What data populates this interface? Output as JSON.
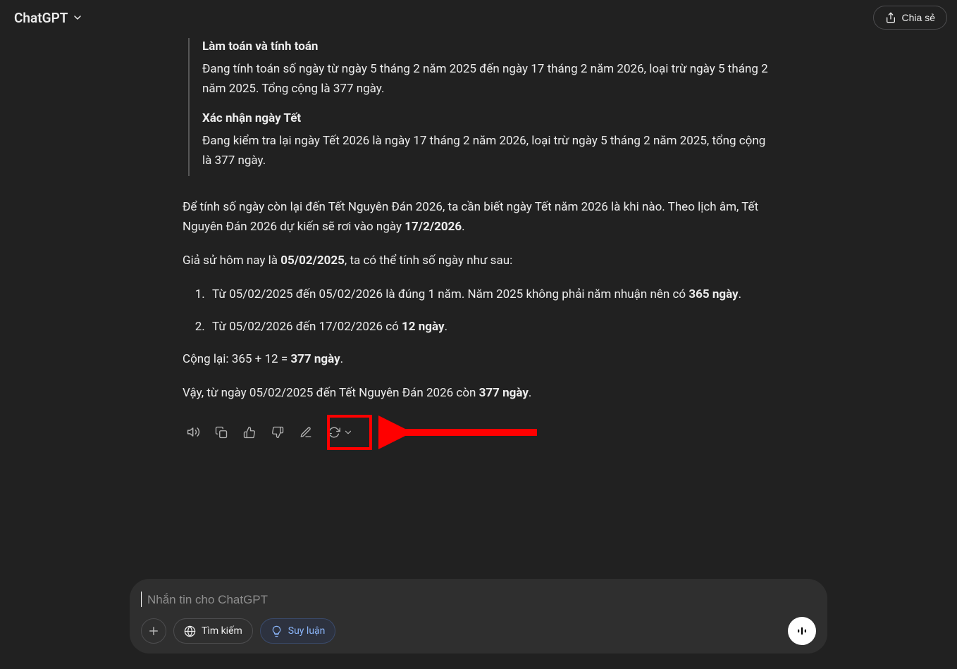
{
  "header": {
    "model_name": "ChatGPT",
    "share_label": "Chia sẻ"
  },
  "reasoning": {
    "heading1": "Làm toán và tính toán",
    "text1": "Đang tính toán số ngày từ ngày 5 tháng 2 năm 2025 đến ngày 17 tháng 2 năm 2026, loại trừ ngày 5 tháng 2 năm 2025. Tổng cộng là 377 ngày.",
    "heading2": "Xác nhận ngày Tết",
    "text2": "Đang kiểm tra lại ngày Tết 2026 là ngày 17 tháng 2 năm 2026, loại trừ ngày 5 tháng 2 năm 2025, tổng cộng là 377 ngày."
  },
  "answer": {
    "p1_a": "Để tính số ngày còn lại đến Tết Nguyên Đán 2026, ta cần biết ngày Tết năm 2026 là khi nào. Theo lịch âm, Tết Nguyên Đán 2026 dự kiến sẽ rơi vào ngày ",
    "p1_b": "17/2/2026",
    "p1_c": ".",
    "p2_a": "Giả sử hôm nay là ",
    "p2_b": "05/02/2025",
    "p2_c": ", ta có thể tính số ngày như sau:",
    "li1_a": "Từ 05/02/2025 đến 05/02/2026 là đúng 1 năm. Năm 2025 không phải năm nhuận nên có ",
    "li1_b": "365 ngày",
    "li1_c": ".",
    "li2_a": "Từ 05/02/2026 đến 17/02/2026 có ",
    "li2_b": "12 ngày",
    "li2_c": ".",
    "p3_a": "Cộng lại: 365 + 12 = ",
    "p3_b": "377 ngày",
    "p3_c": ".",
    "p4_a": "Vậy, từ ngày 05/02/2025 đến Tết Nguyên Đán 2026 còn ",
    "p4_b": "377 ngày",
    "p4_c": "."
  },
  "composer": {
    "placeholder": "Nhắn tin cho ChatGPT",
    "search_label": "Tìm kiếm",
    "reason_label": "Suy luận"
  }
}
